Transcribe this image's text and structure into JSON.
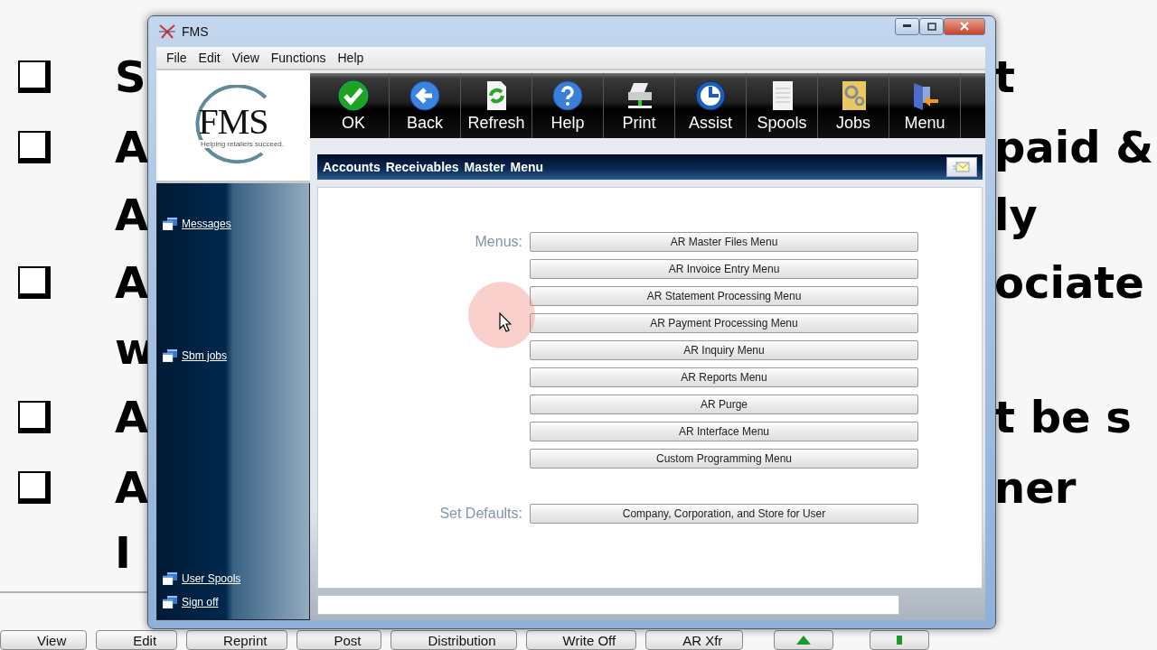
{
  "slide": {
    "rows": [
      {
        "kind": "bullet",
        "left": "S",
        "right": "t"
      },
      {
        "kind": "bullet",
        "left": "A",
        "right": "paid &"
      },
      {
        "kind": "continuation",
        "left": "A",
        "right": "ly"
      },
      {
        "kind": "bullet",
        "left": "A",
        "right": "ociate"
      },
      {
        "kind": "continuation",
        "left": "w"
      },
      {
        "kind": "bullet",
        "left": "A",
        "right": "t be s"
      },
      {
        "kind": "bullet",
        "left": "A",
        "right": "ner"
      },
      {
        "kind": "continuation",
        "left": "I"
      }
    ]
  },
  "taskbar": [
    "View",
    "Edit",
    "Reprint",
    "Post",
    "Distribution",
    "Write Off",
    "AR Xfr"
  ],
  "window": {
    "title": "FMS"
  },
  "menu_bar": [
    "File",
    "Edit",
    "View",
    "Functions",
    "Help"
  ],
  "logo": {
    "name": "FMS",
    "tagline": "Helping retailers succeed."
  },
  "sidebar": {
    "top_links": [
      "Messages",
      "Sbm jobs"
    ],
    "bottom_links": [
      "User Spools",
      "Sign off"
    ]
  },
  "toolbar": [
    "OK",
    "Back",
    "Refresh",
    "Help",
    "Print",
    "Assist",
    "Spools",
    "Jobs",
    "Menu"
  ],
  "page_title": "Accounts Receivables Master Menu",
  "sections": [
    {
      "label": "Menus:",
      "buttons": [
        "AR Master Files Menu",
        "AR Invoice Entry Menu",
        "AR Statement Processing Menu",
        "AR Payment Processing Menu",
        "AR Inquiry Menu",
        "AR Reports Menu",
        "AR Purge",
        "AR Interface Menu",
        "Custom Programming Menu"
      ]
    },
    {
      "label": "Set Defaults:",
      "buttons": [
        "Company, Corporation, and Store for User"
      ]
    }
  ]
}
